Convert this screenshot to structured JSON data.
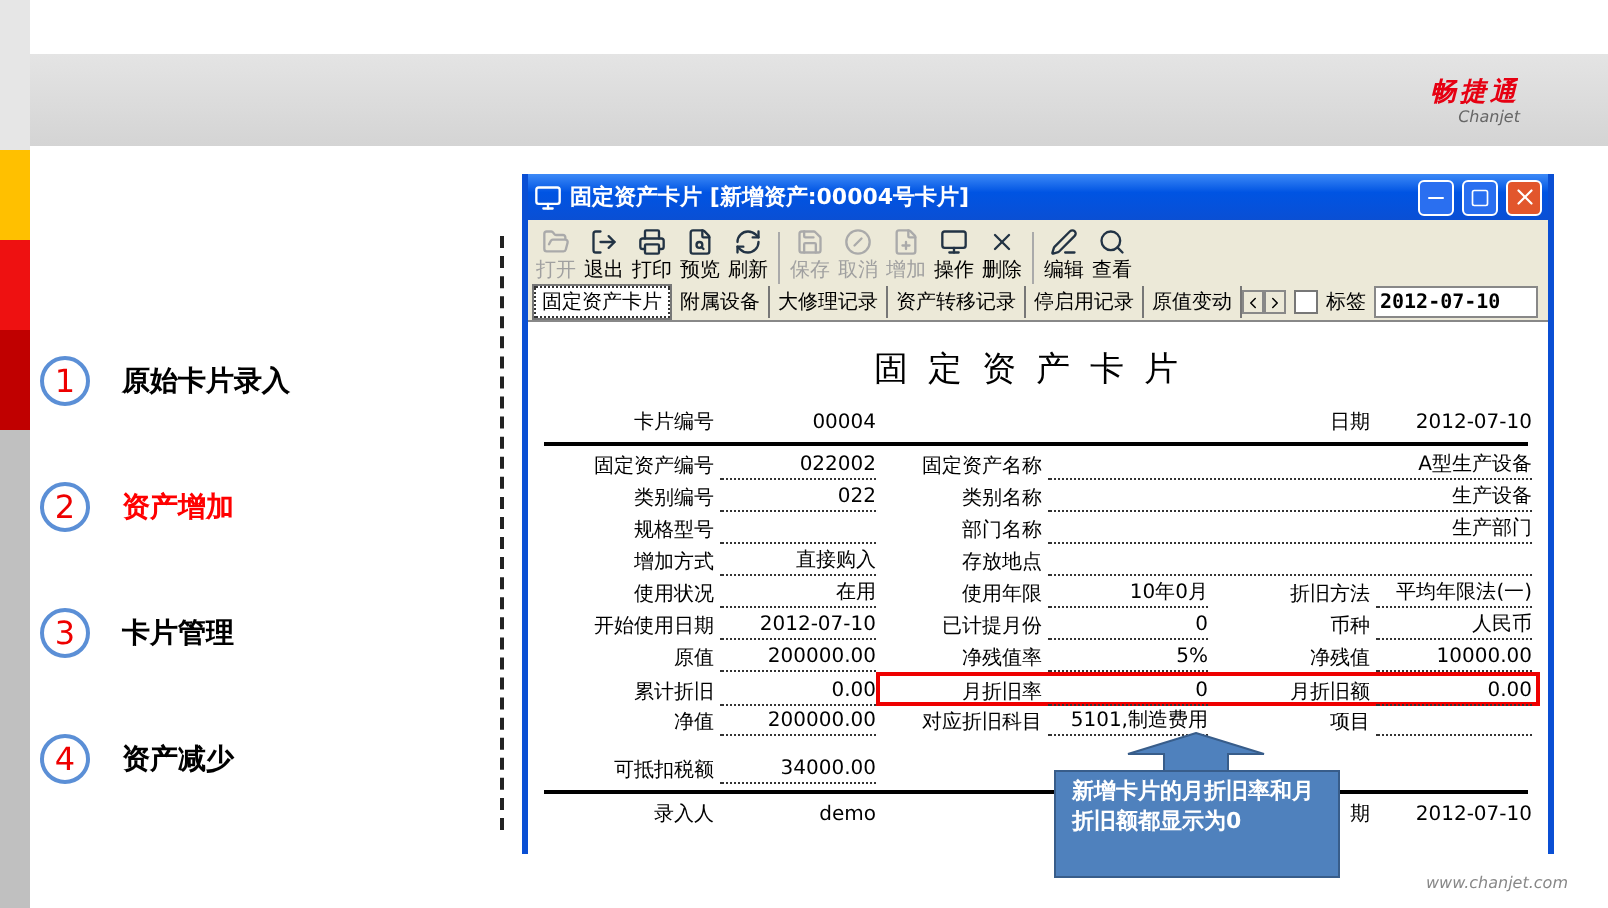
{
  "brand": {
    "name": "畅捷通",
    "latin": "Chanjet"
  },
  "steps": [
    {
      "number": "1",
      "label": "原始卡片录入",
      "selected": false
    },
    {
      "number": "2",
      "label": "资产增加",
      "selected": true
    },
    {
      "number": "3",
      "label": "卡片管理",
      "selected": false
    },
    {
      "number": "4",
      "label": "资产减少",
      "selected": false
    }
  ],
  "window": {
    "title": "固定资产卡片 [新增资产:00004号卡片]"
  },
  "toolbar": [
    {
      "kind": "open",
      "label": "打开",
      "disabled": true
    },
    {
      "kind": "exit",
      "label": "退出",
      "disabled": false
    },
    {
      "kind": "print",
      "label": "打印",
      "disabled": false
    },
    {
      "kind": "preview",
      "label": "预览",
      "disabled": false
    },
    {
      "kind": "refresh",
      "label": "刷新",
      "disabled": false,
      "group_end": true
    },
    {
      "kind": "save",
      "label": "保存",
      "disabled": true
    },
    {
      "kind": "cancel",
      "label": "取消",
      "disabled": true
    },
    {
      "kind": "add",
      "label": "增加",
      "disabled": true
    },
    {
      "kind": "operate",
      "label": "操作",
      "disabled": false
    },
    {
      "kind": "delete",
      "label": "删除",
      "disabled": false,
      "group_end": true
    },
    {
      "kind": "edit",
      "label": "编辑",
      "disabled": false
    },
    {
      "kind": "view",
      "label": "查看",
      "disabled": false
    }
  ],
  "tabs": [
    {
      "label": "固定资产卡片",
      "selected": true
    },
    {
      "label": "附属设备",
      "selected": false
    },
    {
      "label": "大修理记录",
      "selected": false
    },
    {
      "label": "资产转移记录",
      "selected": false
    },
    {
      "label": "停启用记录",
      "selected": false
    },
    {
      "label": "原值变动",
      "selected": false
    }
  ],
  "tag_checkbox": {
    "label": "标签",
    "checked": false
  },
  "date_field": {
    "value": "2012-07-10"
  },
  "card": {
    "title": "固定资产卡片",
    "header": [
      {
        "label": "卡片编号",
        "value": "00004"
      },
      {
        "label": "日期",
        "value": "2012-07-10"
      }
    ],
    "rows": [
      {
        "highlighted": false,
        "fields": [
          {
            "label": "固定资产编号",
            "value": "022002"
          },
          {
            "label": "固定资产名称",
            "value": "A型生产设备",
            "wide": true
          }
        ]
      },
      {
        "highlighted": false,
        "fields": [
          {
            "label": "类别编号",
            "value": "022"
          },
          {
            "label": "类别名称",
            "value": "生产设备",
            "wide": true
          }
        ]
      },
      {
        "highlighted": false,
        "fields": [
          {
            "label": "规格型号"
          },
          {
            "label": "部门名称",
            "value": "生产部门",
            "wide": true
          }
        ]
      },
      {
        "highlighted": false,
        "fields": [
          {
            "label": "增加方式",
            "value": "直接购入"
          },
          {
            "label": "存放地点",
            "wide": true
          }
        ]
      },
      {
        "highlighted": false,
        "fields": [
          {
            "label": "使用状况",
            "value": "在用"
          },
          {
            "label": "使用年限",
            "value": "10年0月"
          },
          {
            "label": "折旧方法",
            "value": "平均年限法(一)"
          }
        ]
      },
      {
        "highlighted": false,
        "fields": [
          {
            "label": "开始使用日期",
            "value": "2012-07-10"
          },
          {
            "label": "已计提月份",
            "value": "0"
          },
          {
            "label": "币种",
            "value": "人民币"
          }
        ]
      },
      {
        "highlighted": false,
        "fields": [
          {
            "label": "原值",
            "value": "200000.00"
          },
          {
            "label": "净残值率",
            "value": "5%"
          },
          {
            "label": "净残值",
            "value": "10000.00"
          }
        ]
      },
      {
        "highlighted": true,
        "fields": [
          {
            "label": "累计折旧",
            "value": "0.00"
          },
          {
            "label": "月折旧率",
            "value": "0"
          },
          {
            "label": "月折旧额",
            "value": "0.00"
          }
        ]
      },
      {
        "highlighted": false,
        "fields": [
          {
            "label": "净值",
            "value": "200000.00"
          },
          {
            "label": "对应折旧科目",
            "value": "5101,制造费用"
          },
          {
            "label": "项目"
          }
        ]
      },
      {
        "highlighted": false,
        "fields": [
          {
            "label": "可抵扣税额",
            "value": "34000.00"
          }
        ]
      }
    ],
    "footer": [
      {
        "label": "录入人",
        "value": "demo"
      },
      {
        "label": "期",
        "value": "2012-07-10"
      }
    ]
  },
  "callout": {
    "text": "新增卡片的月折旧率和月折旧额都显示为0"
  },
  "site": "www.chanjet.com"
}
